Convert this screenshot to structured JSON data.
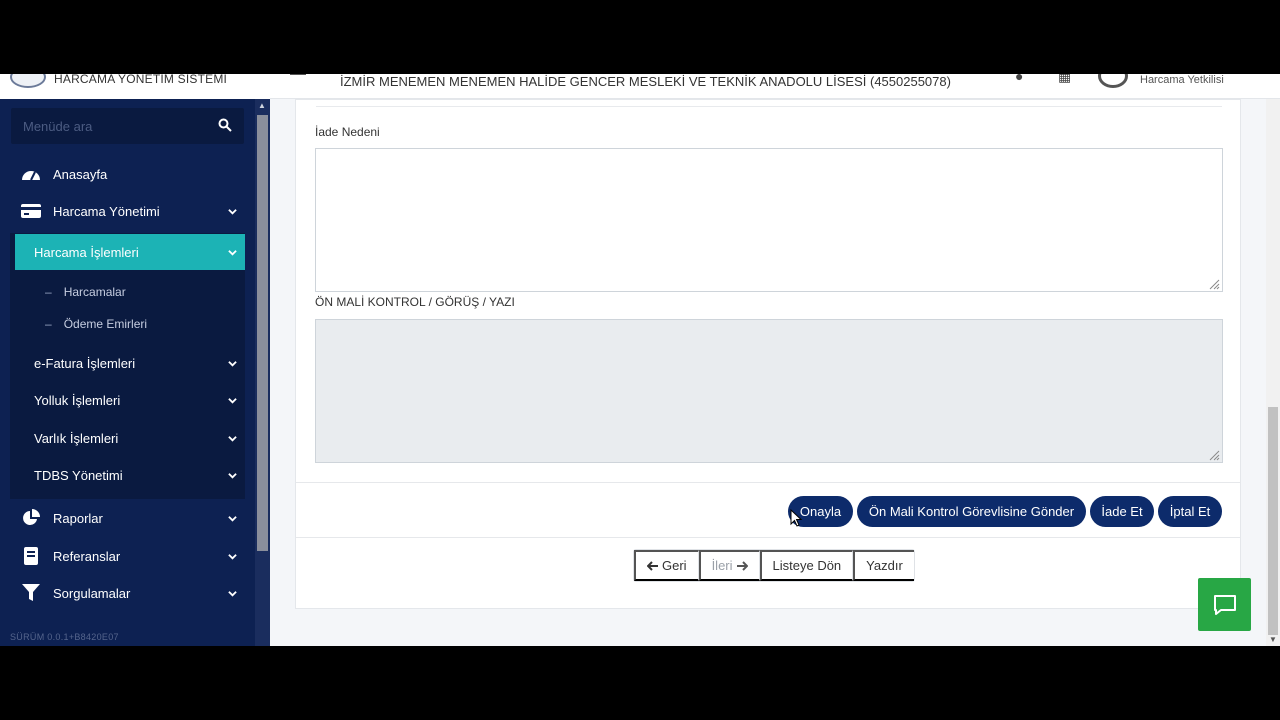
{
  "header": {
    "app_title": "HARCAMA YÖNETİM SİSTEMİ",
    "school_name": "İZMİR MENEMEN MENEMEN HALİDE GENCER MESLEKİ VE TEKNİK ANADOLU LİSESİ (4550255078)",
    "user_role": "Harcama Yetkilisi"
  },
  "sidebar": {
    "search_placeholder": "Menüde ara",
    "items": {
      "home": "Anasayfa",
      "spending_mgmt": "Harcama Yönetimi",
      "spending_ops": "Harcama İşlemleri",
      "spendings": "Harcamalar",
      "payment_orders": "Ödeme Emirleri",
      "efatura": "e-Fatura İşlemleri",
      "travel": "Yolluk İşlemleri",
      "assets": "Varlık İşlemleri",
      "tdbs": "TDBS Yönetimi",
      "reports": "Raporlar",
      "references": "Referanslar",
      "queries": "Sorgulamalar"
    },
    "version": "SÜRÜM 0.0.1+B8420E07"
  },
  "form": {
    "return_reason_label": "İade Nedeni",
    "return_reason_value": "",
    "pre_control_label": "ÖN MALİ KONTROL / GÖRÜŞ / YAZI",
    "pre_control_value": ""
  },
  "actions": {
    "approve": "Onayla",
    "send_pre_control": "Ön Mali Kontrol Görevlisine Gönder",
    "return": "İade Et",
    "cancel": "İptal Et"
  },
  "pager": {
    "back": "Geri",
    "next": "İleri",
    "to_list": "Listeye Dön",
    "print": "Yazdır"
  },
  "colors": {
    "sidebar_bg": "#0d2152",
    "active_item": "#1cb3b5",
    "primary_button": "#0d2b6b",
    "chat_button": "#28a745"
  }
}
